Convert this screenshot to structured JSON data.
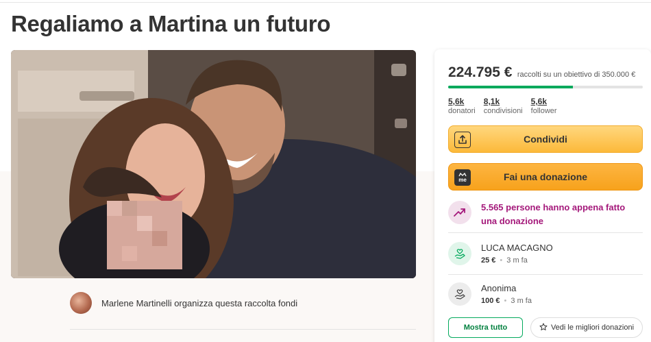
{
  "page": {
    "title": "Regaliamo a Martina un futuro"
  },
  "organizer": {
    "text": "Marlene Martinelli organizza questa raccolta fondi"
  },
  "donation_card": {
    "amount": "224.795 €",
    "goal_text": "raccolti su un obiettivo di 350.000 €",
    "progress_fraction": 0.642,
    "stats": [
      {
        "value": "5,6k",
        "label": "donatori"
      },
      {
        "value": "8,1k",
        "label": "condivisioni"
      },
      {
        "value": "5,6k",
        "label": "follower"
      }
    ],
    "share_label": "Condividi",
    "donate_label": "Fai una donazione",
    "donate_icon_text": "me",
    "recent_activity": "5.565 persone hanno appena fatto una donazione",
    "donors": [
      {
        "name": "LUCA MACAGNO",
        "amount": "25 €",
        "time": "3 m fa"
      },
      {
        "name": "Anonima",
        "amount": "100 €",
        "time": "3 m fa"
      }
    ],
    "show_all_label": "Mostra tutto",
    "top_donations_label": "Vedi le migliori donazioni"
  },
  "colors": {
    "accent_green": "#02a95c",
    "donate_orange": "#f7a21c",
    "share_yellow": "#fcb93a",
    "activity_magenta": "#a4187a"
  },
  "icons": {
    "share": "share-icon",
    "donate": "gofundme-logo-icon",
    "trend": "trending-up-icon",
    "donor": "hand-heart-icon",
    "star": "star-icon"
  }
}
